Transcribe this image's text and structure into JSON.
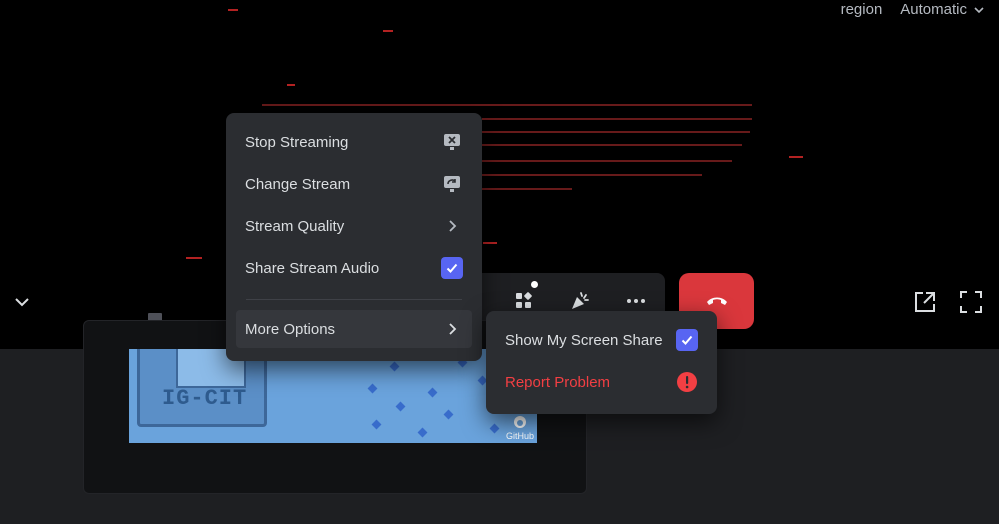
{
  "top_bar": {
    "region_label": "region",
    "region_value": "Automatic"
  },
  "stream_menu": {
    "items": [
      {
        "label": "Stop Streaming",
        "icon": "stop-stream-icon"
      },
      {
        "label": "Change Stream",
        "icon": "change-stream-icon"
      },
      {
        "label": "Stream Quality",
        "icon": "chevron-right-icon"
      },
      {
        "label": "Share Stream Audio",
        "icon": "checkbox-checked",
        "checked": true
      }
    ],
    "more_options": {
      "label": "More Options",
      "icon": "chevron-right-icon"
    }
  },
  "more_options_submenu": {
    "items": [
      {
        "label": "Show My Screen Share",
        "icon": "checkbox-checked",
        "checked": true
      },
      {
        "label": "Report Problem",
        "icon": "warning-circle-icon",
        "danger": true
      }
    ]
  },
  "stream_preview": {
    "image_text": "IG-CIT",
    "logo_text": "GitHub"
  },
  "colors": {
    "accent": "#5865f2",
    "danger": "#da373c",
    "danger_text": "#f23f43",
    "menu_bg": "#2b2d31",
    "hover_bg": "#35373c"
  }
}
